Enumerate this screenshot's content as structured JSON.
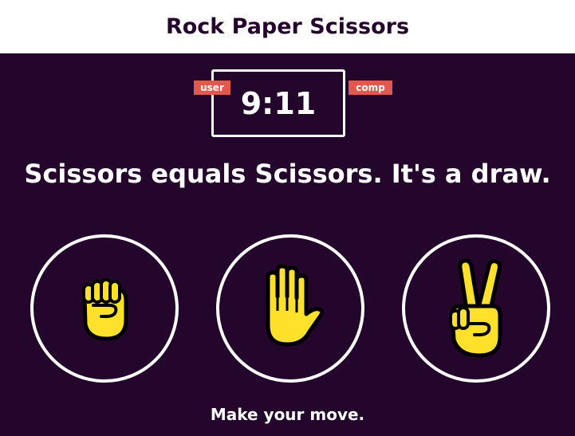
{
  "header": {
    "title": "Rock Paper Scissors"
  },
  "scoreboard": {
    "user_label": "user",
    "comp_label": "comp",
    "score_text": "9:11",
    "user_score": 9,
    "comp_score": 11
  },
  "result": {
    "message": "Scissors equals Scissors. It's a draw."
  },
  "choices": [
    {
      "name": "rock",
      "icon": "rock-fist-icon"
    },
    {
      "name": "paper",
      "icon": "paper-hand-icon"
    },
    {
      "name": "scissors",
      "icon": "scissors-hand-icon"
    }
  ],
  "prompt": {
    "message": "Make your move."
  },
  "colors": {
    "background": "#24052b",
    "header_bg": "#ffffff",
    "badge": "#e2584d",
    "hand_fill": "#ffe02a",
    "outline": "#ffffff"
  }
}
